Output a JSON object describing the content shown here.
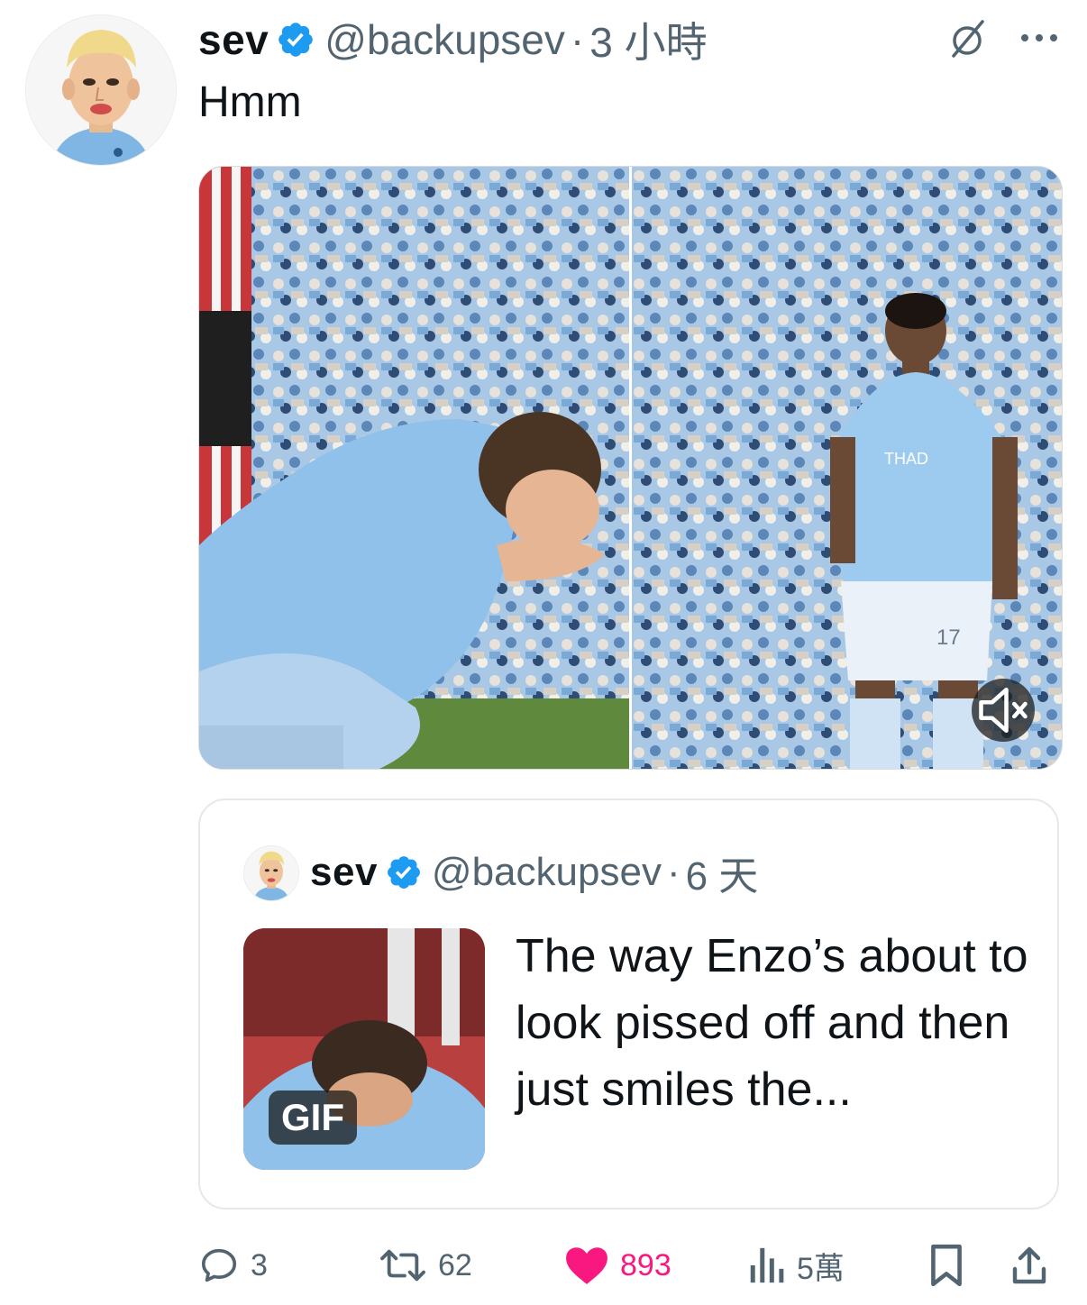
{
  "tweet": {
    "author_name": "sev",
    "handle": "@backupsev",
    "separator": "·",
    "time": "3 小時",
    "text": "Hmm"
  },
  "media": {
    "jersey_number": "17",
    "sponsor_text": "THAD"
  },
  "quoted_tweet": {
    "author_name": "sev",
    "handle": "@backupsev",
    "separator": "·",
    "time": "6 天",
    "gif_label": "GIF",
    "text": "The way Enzo’s about to look pissed off and then just smiles the..."
  },
  "actions": {
    "replies": "3",
    "reposts": "62",
    "likes": "893",
    "views": "5萬"
  },
  "colors": {
    "verified": "#1d9bf0",
    "like": "#f91880",
    "secondary_text": "#536471",
    "primary_text": "#0f1419"
  },
  "icons": [
    "verified-icon",
    "grok-icon",
    "more-icon",
    "mute-icon",
    "reply-icon",
    "repost-icon",
    "like-icon",
    "views-icon",
    "bookmark-icon",
    "share-icon"
  ]
}
